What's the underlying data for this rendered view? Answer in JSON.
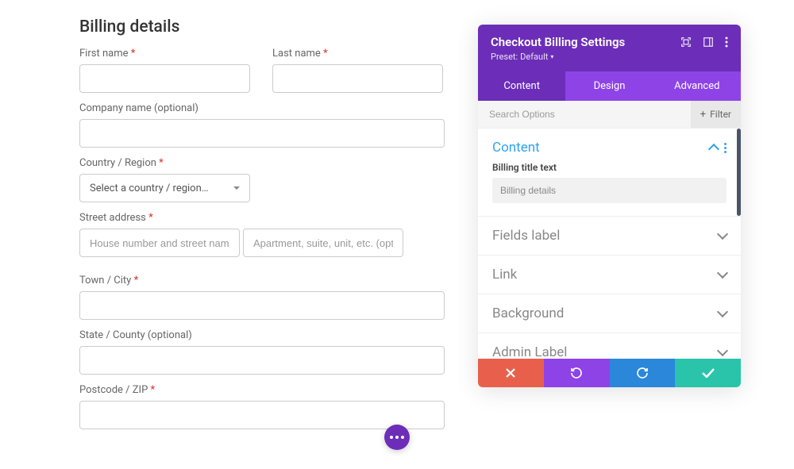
{
  "form": {
    "title": "Billing details",
    "first_name_label": "First name",
    "last_name_label": "Last name",
    "company_label": "Company name (optional)",
    "country_label": "Country / Region",
    "country_placeholder": "Select a country / region…",
    "street_label": "Street address",
    "street_placeholder1": "House number and street name",
    "street_placeholder2": "Apartment, suite, unit, etc. (optional)",
    "city_label": "Town / City",
    "state_label": "State / County (optional)",
    "postcode_label": "Postcode / ZIP"
  },
  "panel": {
    "title": "Checkout Billing Settings",
    "preset_prefix": "Preset:",
    "preset_value": "Default",
    "tabs": {
      "content": "Content",
      "design": "Design",
      "advanced": "Advanced"
    },
    "search_placeholder": "Search Options",
    "filter_label": "Filter",
    "sections": {
      "content": "Content",
      "fields_label": "Fields label",
      "link": "Link",
      "background": "Background",
      "admin_label": "Admin Label"
    },
    "billing_title_label": "Billing title text",
    "billing_title_value": "Billing details"
  }
}
